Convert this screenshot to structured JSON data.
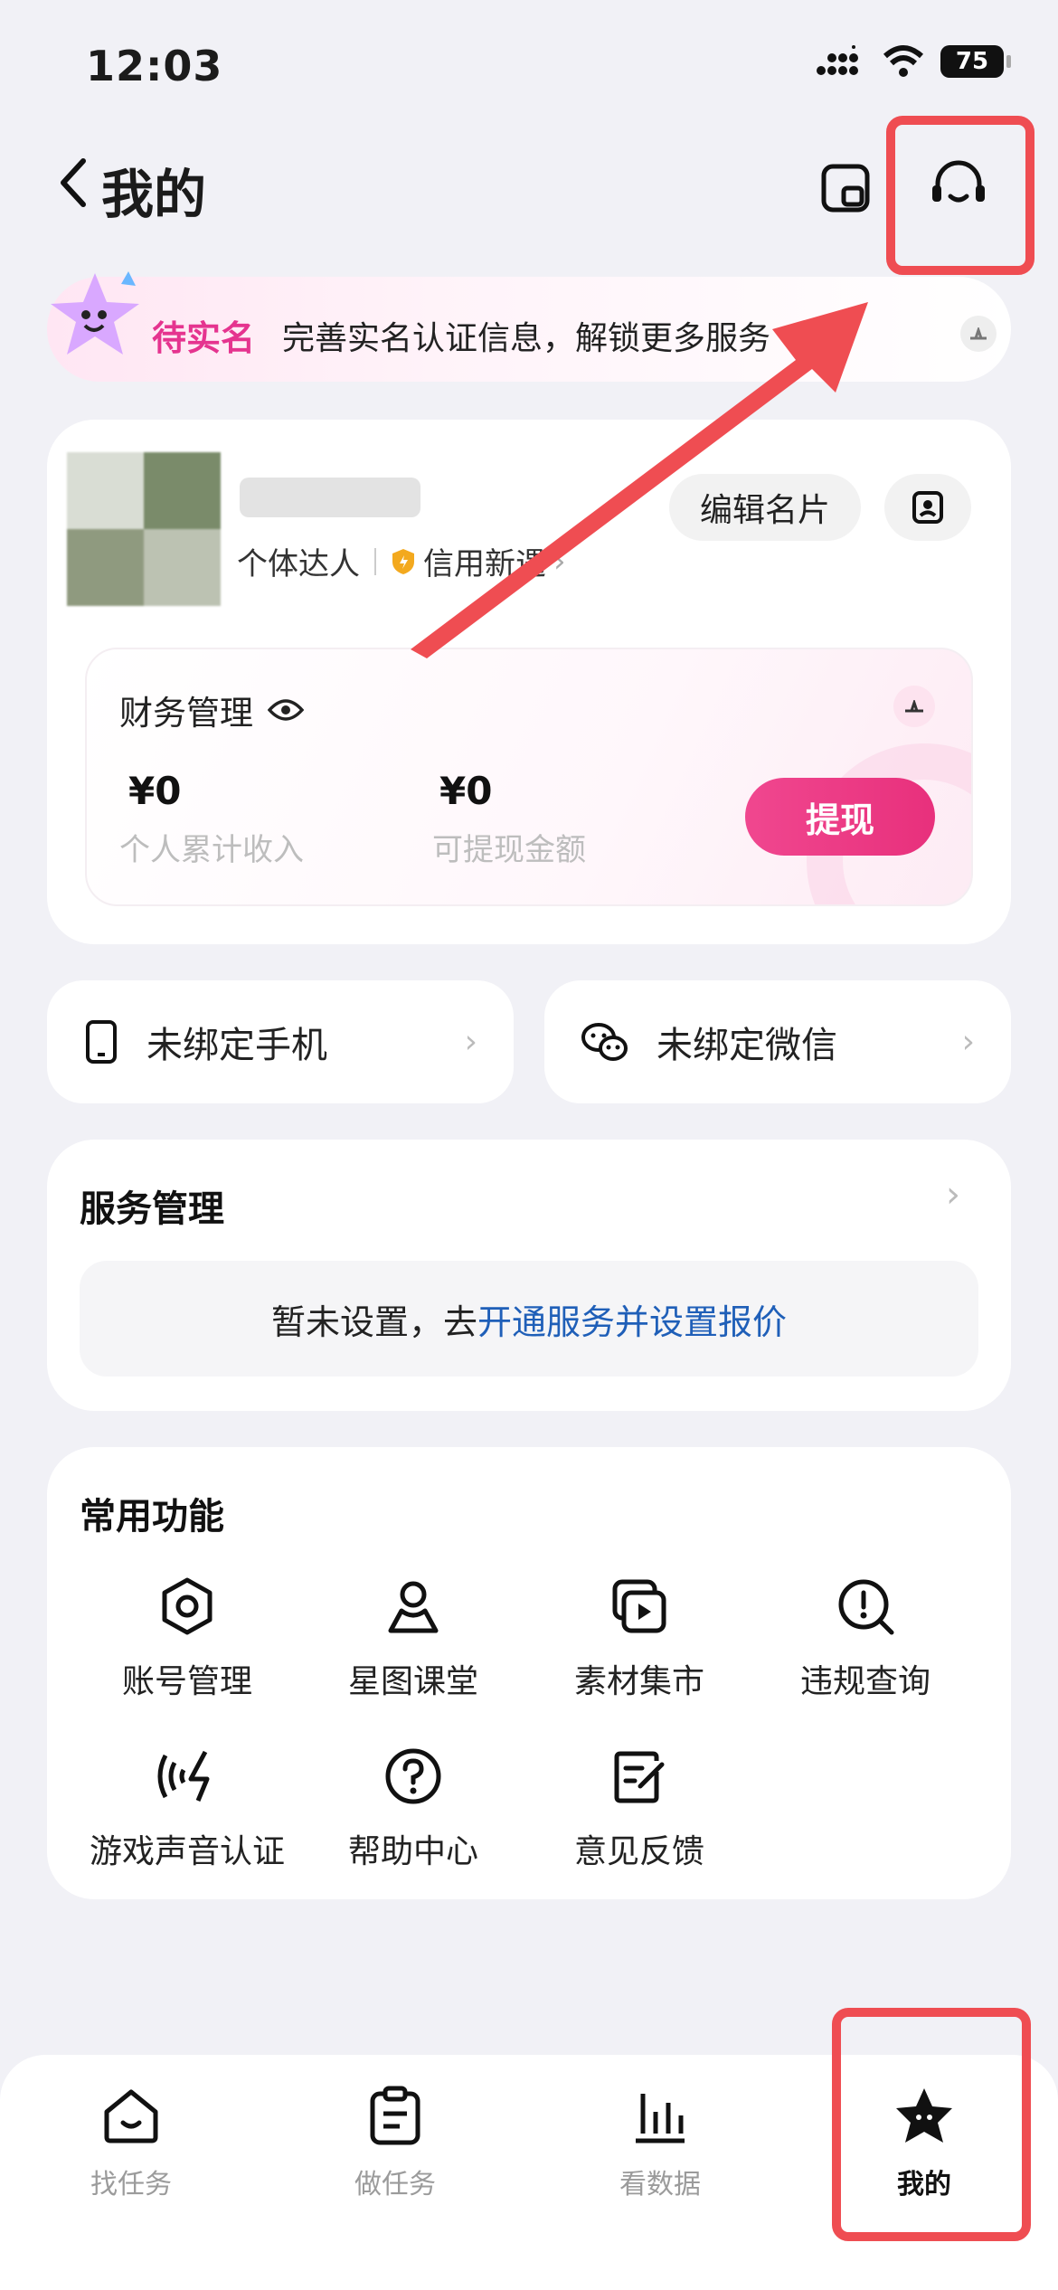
{
  "status_bar": {
    "time": "12:03",
    "battery": "75"
  },
  "header": {
    "title": "我的"
  },
  "banner": {
    "tag": "待实名",
    "text": "完善实名认证信息，解锁更多服务"
  },
  "profile": {
    "identity": "个体达人",
    "credit": "信用新遇",
    "edit_label": "编辑名片"
  },
  "finance": {
    "title": "财务管理",
    "income_amount": "¥0",
    "income_label": "个人累计收入",
    "withdrawable_amount": "¥0",
    "withdrawable_label": "可提现金额",
    "withdraw_button": "提现"
  },
  "bindings": {
    "phone": "未绑定手机",
    "wechat": "未绑定微信"
  },
  "service": {
    "title": "服务管理",
    "empty_prefix": "暂未设置，去",
    "empty_link": "开通服务并设置报价"
  },
  "functions": {
    "title": "常用功能",
    "items": [
      {
        "label": "账号管理",
        "icon": "hexagon-gear-icon"
      },
      {
        "label": "星图课堂",
        "icon": "person-icon"
      },
      {
        "label": "素材集市",
        "icon": "video-library-icon"
      },
      {
        "label": "违规查询",
        "icon": "alert-search-icon"
      },
      {
        "label": "游戏声音认证",
        "icon": "sound-wave-icon"
      },
      {
        "label": "帮助中心",
        "icon": "question-icon"
      },
      {
        "label": "意见反馈",
        "icon": "feedback-edit-icon"
      }
    ]
  },
  "tabs": [
    {
      "label": "找任务",
      "icon": "home-smile-icon"
    },
    {
      "label": "做任务",
      "icon": "clipboard-icon"
    },
    {
      "label": "看数据",
      "icon": "bar-chart-icon"
    },
    {
      "label": "我的",
      "icon": "star-face-icon"
    }
  ],
  "colors": {
    "accent": "#e8307c",
    "highlight": "#ef4d52",
    "link": "#1f5fb8"
  }
}
